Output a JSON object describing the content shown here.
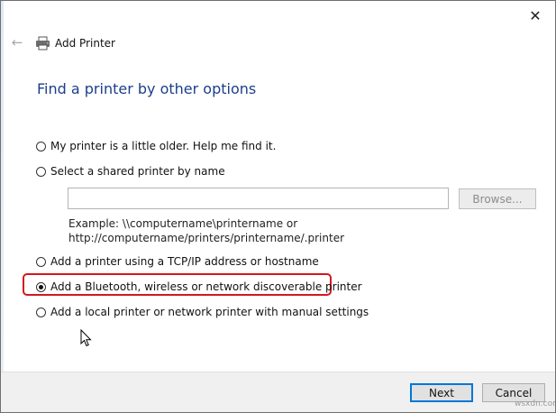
{
  "window": {
    "title": "Add Printer",
    "close_glyph": "✕",
    "back_glyph": "←"
  },
  "heading": "Find a printer by other options",
  "options": [
    {
      "label": "My printer is a little older. Help me find it.",
      "checked": false
    },
    {
      "label": "Select a shared printer by name",
      "checked": false
    },
    {
      "label": "Add a printer using a TCP/IP address or hostname",
      "checked": false
    },
    {
      "label": "Add a Bluetooth, wireless or network discoverable printer",
      "checked": true
    },
    {
      "label": "Add a local printer or network printer with manual settings",
      "checked": false
    }
  ],
  "shared_printer": {
    "input_value": "",
    "browse_label": "Browse...",
    "example_line1": "Example: \\\\computername\\printername or",
    "example_line2": "http://computername/printers/printername/.printer"
  },
  "footer": {
    "next_label": "Next",
    "cancel_label": "Cancel"
  },
  "watermark": "wsxdn.com",
  "colors": {
    "heading": "#1b3f8b",
    "highlight": "#d4181c",
    "default_button_border": "#0078d7"
  },
  "icons": {
    "title_icon": "printer-icon",
    "back": "back-arrow-icon",
    "close": "close-icon",
    "pointer": "mouse-cursor-icon"
  }
}
